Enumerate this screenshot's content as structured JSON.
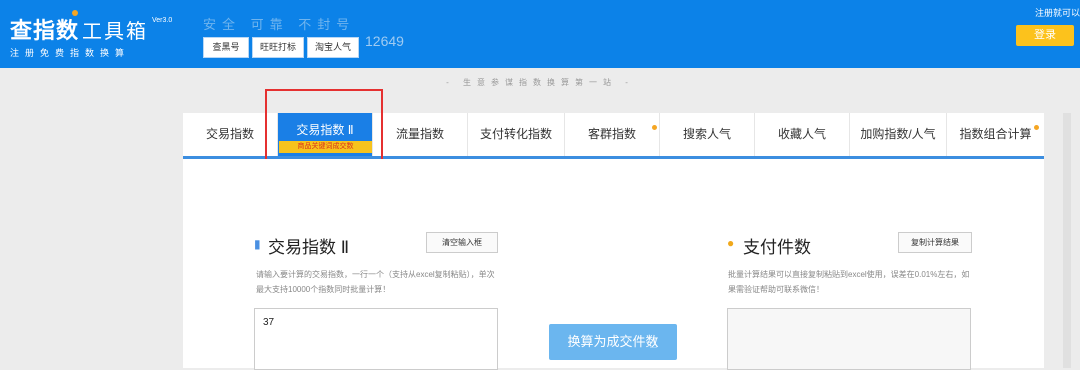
{
  "header": {
    "logo_main": "查指数",
    "logo_sub": "工具箱",
    "logo_version": "Ver3.0",
    "logo_slogan": "注册免费指数换算",
    "tagline": "安全 可靠 不封号",
    "buttons": [
      "查黑号",
      "旺旺打标",
      "淘宝人气"
    ],
    "counter": "12649",
    "register_text": "注册就可以",
    "login_label": "登录"
  },
  "banner_slogan": "- 生意参谋指数换算第一站 -",
  "tabs": {
    "items": [
      "交易指数",
      "交易指数 Ⅱ",
      "流量指数",
      "支付转化指数",
      "客群指数",
      "搜索人气",
      "收藏人气",
      "加购指数/人气",
      "指数组合计算"
    ],
    "active_sub": "商品关键词成交数"
  },
  "left_panel": {
    "title": "交易指数 Ⅱ",
    "clear_button": "清空输入框",
    "description": "请输入要计算的交易指数，一行一个（支持从excel复制粘贴），单次最大支持10000个指数同时批量计算！",
    "input_value": "37"
  },
  "convert_button": "换算为成交件数",
  "right_panel": {
    "title": "支付件数",
    "copy_button": "复制计算结果",
    "description": "批量计算结果可以直接复制粘贴到excel使用，误差在0.01%左右，如果需验证帮助可联系微信！",
    "output_value": ""
  },
  "colors": {
    "header_blue": "#0c82e8",
    "login_yellow": "#fcc21c",
    "active_tab": "#1a7fe6",
    "highlight_red": "#e53030"
  }
}
